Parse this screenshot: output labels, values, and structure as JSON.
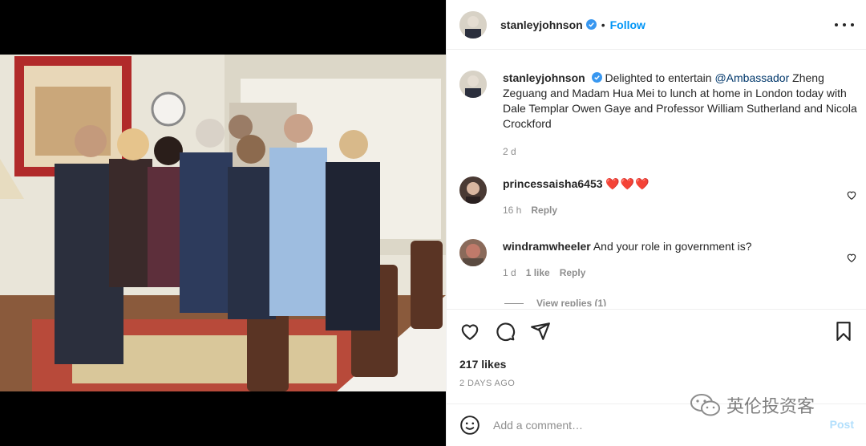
{
  "post": {
    "username": "stanleyjohnson",
    "follow_label": "Follow",
    "separator": "•",
    "caption_mention": "@Ambassador",
    "caption_before": "Delighted to entertain ",
    "caption_after": " Zheng Zeguang and Madam Hua Mei to lunch at home in London today with Dale Templar Owen Gaye and Professor William Sutherland and Nicola Crockford",
    "caption_age": "2 d"
  },
  "comments": [
    {
      "username": "princessaisha6453",
      "text": "❤️❤️❤️",
      "age": "16 h",
      "likes": "",
      "reply_label": "Reply"
    },
    {
      "username": "windramwheeler",
      "text": "And your role in government is?",
      "age": "1 d",
      "likes": "1 like",
      "reply_label": "Reply"
    }
  ],
  "view_replies": "View replies (1)",
  "likes_count": "217 likes",
  "posted_ago": "2 DAYS AGO",
  "add_comment": {
    "placeholder": "Add a comment…",
    "post_label": "Post"
  },
  "watermark": "英伦投资客",
  "colors": {
    "accent": "#0095f6",
    "verified": "#3897f0",
    "post_disabled": "#b2dffc"
  }
}
